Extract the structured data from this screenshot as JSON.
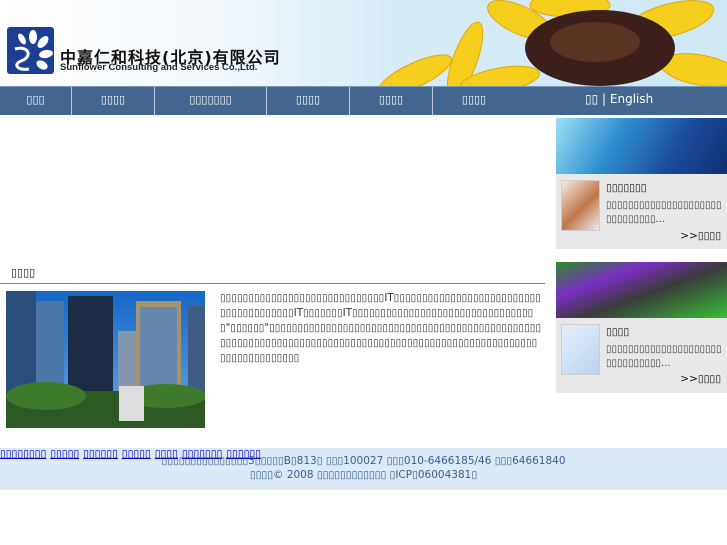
{
  "logo": {
    "name_cn": "中嘉仁和科技(北京)有限公司",
    "name_en": "Sunflower Consulting and Services Co.,Ltd."
  },
  "nav": {
    "items": [
      "▯▯▯",
      "▯▯▯▯",
      "▯▯▯▯▯▯▯",
      "▯▯▯▯",
      "▯▯▯▯",
      "▯▯▯▯"
    ],
    "lang_cn": "▯▯",
    "lang_sep": " | ",
    "lang_en": "English"
  },
  "main": {
    "section_title": "▯▯▯▯",
    "paragraph": "▯▯▯▯▯▯▯▯▯▯▯▯▯▯▯▯▯▯▯▯▯▯▯▯▯▯▯▯▯IT▯▯▯▯▯▯▯▯▯▯▯▯▯▯▯▯▯▯▯▯▯▯▯▯▯▯▯▯▯▯▯▯▯▯▯▯▯▯▯IT▯▯▯▯▯▯▯IT▯▯▯▯▯▯▯▯▯▯▯▯▯▯▯▯▯▯▯▯▯▯▯▯▯▯▯▯▯▯▯▯▯\"▯▯▯▯▯▯\"▯▯▯▯▯▯▯▯▯▯▯▯▯▯▯▯▯▯▯▯▯▯▯▯▯▯▯▯▯▯▯▯▯▯▯▯▯▯▯▯▯▯▯▯▯▯▯▯▯▯▯▯▯▯▯▯▯▯▯▯▯▯▯▯▯▯▯▯▯▯▯▯▯▯▯▯▯▯▯▯▯▯▯▯▯▯▯▯▯▯▯▯▯▯▯▯▯▯▯▯▯▯▯▯▯▯▯▯▯▯▯▯▯▯▯▯▯▯"
  },
  "sidebar": {
    "cards": [
      {
        "title": "▯▯▯▯▯▯▯",
        "text": "▯▯▯▯▯▯▯▯▯▯▯▯▯▯▯▯▯▯▯▯▯▯▯▯▯▯▯▯▯▯...",
        "more": ">>▯▯▯▯"
      },
      {
        "title": "▯▯▯▯",
        "text": "▯▯▯▯▯▯▯▯▯▯▯▯▯▯▯▯▯▯▯▯▯▯▯▯▯▯▯▯▯▯▯...",
        "more": ">>▯▯▯▯"
      }
    ]
  },
  "footer": {
    "links": [
      "▯▯▯▯▯▯▯▯",
      "▯▯▯▯▯",
      "▯▯▯▯▯▯",
      "▯▯▯▯▯",
      "▯▯▯▯",
      "▯▯▯▯▯▯▯",
      "▯▯▯▯▯▯"
    ],
    "address": "▯▯▯▯▯▯▯▯▯▯▯▯▯▯▯3▯▯▯▯▯B▯813▯ ▯▯▯100027 ▯▯▯010-6466185/46 ▯▯▯64661840",
    "copyright": "▯▯▯▯© 2008 ▯▯▯▯▯▯▯▯▯▯▯▯ ▯ICP▯06004381▯"
  }
}
